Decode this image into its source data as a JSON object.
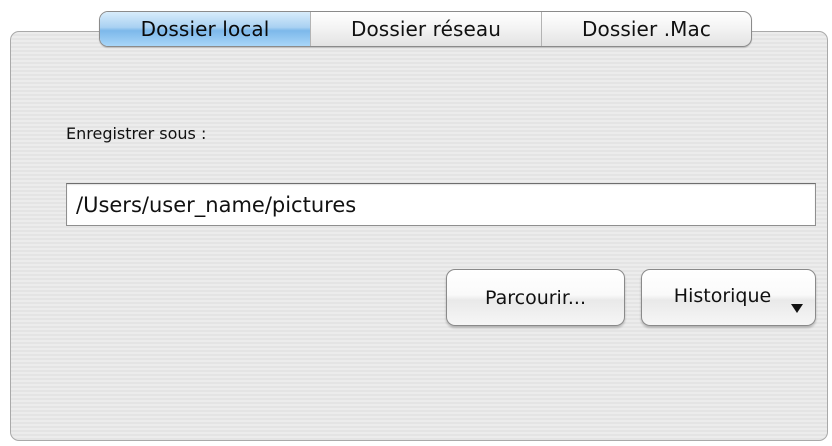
{
  "tabs": [
    {
      "label": "Dossier local",
      "active": true
    },
    {
      "label": "Dossier réseau",
      "active": false
    },
    {
      "label": "Dossier .Mac",
      "active": false
    }
  ],
  "save_as": {
    "label": "Enregistrer sous :",
    "value": "/Users/user_name/pictures"
  },
  "buttons": {
    "browse": "Parcourir...",
    "history": "Historique"
  },
  "icons": {
    "history_dropdown": "chevron-down-icon"
  },
  "colors": {
    "active_tab": "#a9d1f2",
    "panel": "#e9e9e9"
  }
}
